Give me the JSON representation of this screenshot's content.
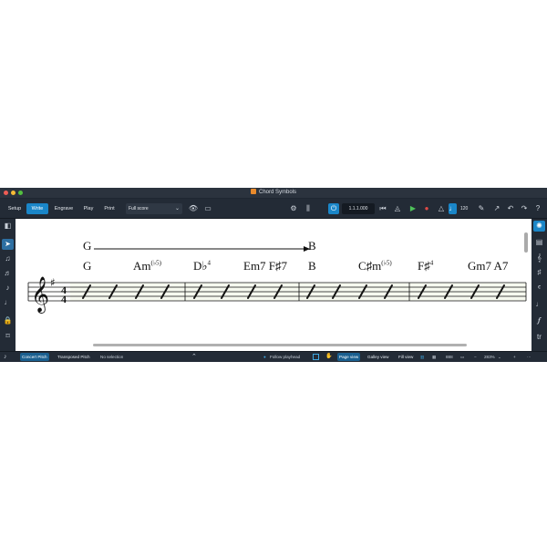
{
  "window": {
    "title": "Chord Symbols"
  },
  "toolbar": {
    "modes": [
      {
        "label": "Setup",
        "active": false
      },
      {
        "label": "Write",
        "active": true
      },
      {
        "label": "Engrave",
        "active": false
      },
      {
        "label": "Play",
        "active": false
      },
      {
        "label": "Print",
        "active": false
      }
    ],
    "layout_select": "Full score",
    "time_position": "1.1.1.000",
    "tempo": "120"
  },
  "score": {
    "chords_upper": [
      {
        "root": "G",
        "sup": ""
      },
      {
        "root": "B",
        "sup": ""
      }
    ],
    "chords_lower": [
      {
        "root": "G",
        "sup": ""
      },
      {
        "root": "Am",
        "sup": "(♭5)"
      },
      {
        "root": "D♭",
        "sup": "4"
      },
      {
        "root": "Em7 F♯7",
        "sup": ""
      },
      {
        "root": "B",
        "sup": ""
      },
      {
        "root": "C♯m",
        "sup": "(♭5)"
      },
      {
        "root": "F♯",
        "sup": "4"
      },
      {
        "root": "Gm7 A7",
        "sup": ""
      }
    ]
  },
  "statusbar": {
    "concert_pitch": "Concert Pitch",
    "transposed_pitch": "Transposed Pitch",
    "selection": "No selection",
    "follow_playhead": "Follow playhead",
    "views": [
      {
        "label": "Page view",
        "active": true
      },
      {
        "label": "Galley view",
        "active": false
      },
      {
        "label": "Fill view",
        "active": false
      }
    ],
    "page_count": "888",
    "zoom": "283%"
  },
  "colors": {
    "accent": "#1a86c8",
    "chrome": "#1f2732",
    "staff_bg": "#f6f9ef"
  }
}
